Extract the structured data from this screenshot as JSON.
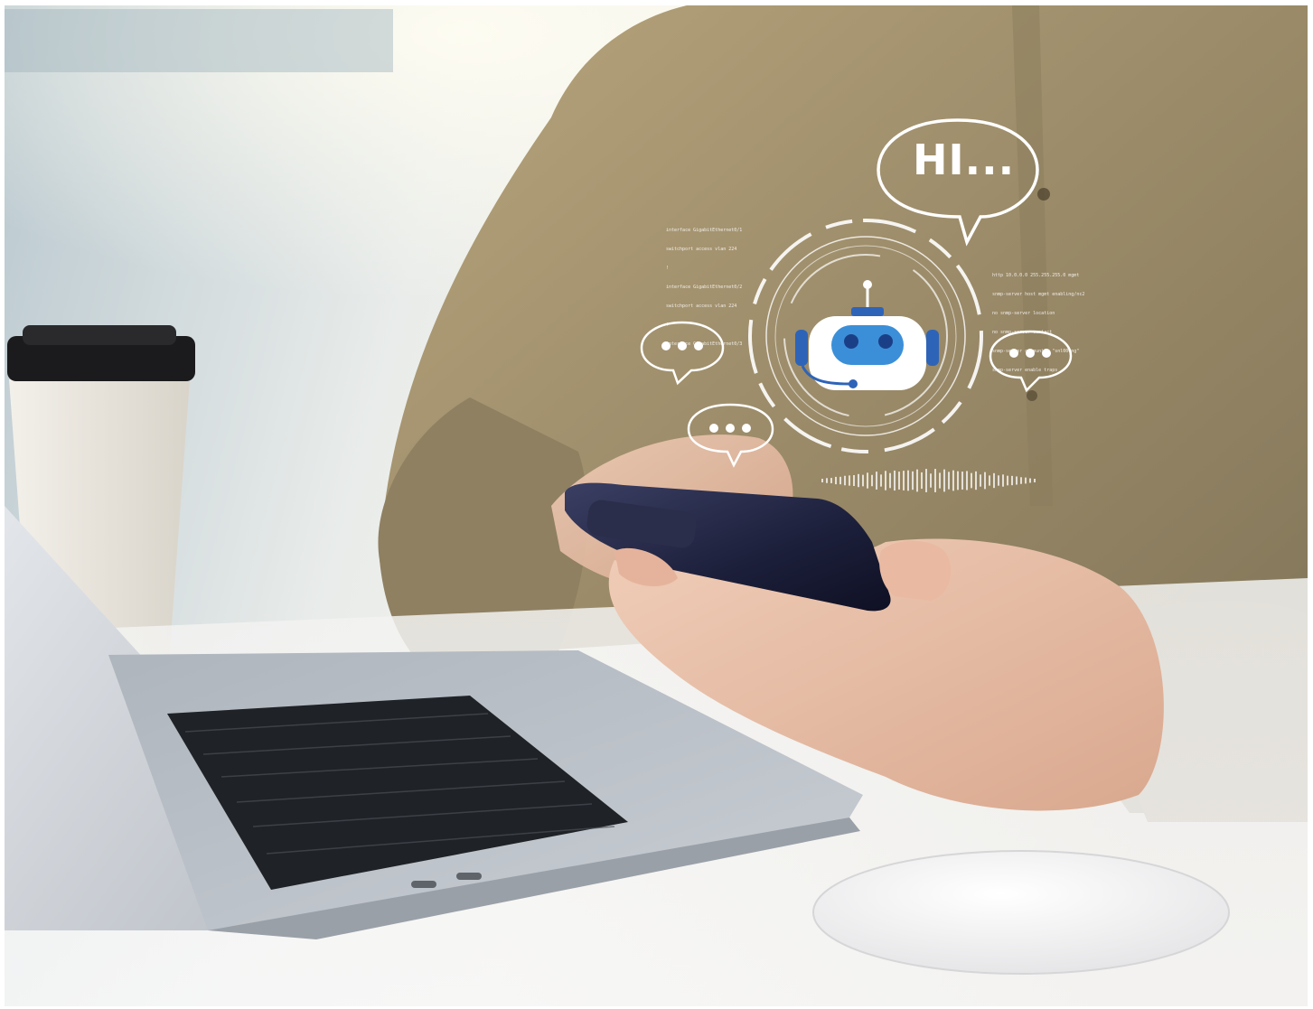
{
  "image": {
    "subject": "hand holding smartphone at desk with laptop, coffee cup and mouse",
    "overlay": {
      "greeting": "HI...",
      "left_typing_dots": "•••",
      "right_typing_dots": "•••",
      "bottom_typing_dots": "•••",
      "code_left": [
        "interface GigabitEthernet0/1",
        "switchport access vlan 224",
        "!",
        "interface GigabitEthernet0/2",
        "switchport access vlan 224",
        "!",
        "interface GigabitEthernet0/3"
      ],
      "code_right": [
        "http 10.0.0.0 255.255.255.0 mgmt",
        "snmp-server host mgmt enabling/nc2",
        "no snmp-server location",
        "no snmp-server contact",
        "snmp-server community \"snl004ng\"",
        "snmp-server enable traps"
      ]
    },
    "colors": {
      "shirt": "#9a8a68",
      "robot_blue": "#2e64b8",
      "overlay_white": "#ffffff"
    },
    "icons": [
      "robot-icon",
      "speech-bubble-icon",
      "typing-bubble-icon",
      "sound-wave-icon"
    ]
  }
}
